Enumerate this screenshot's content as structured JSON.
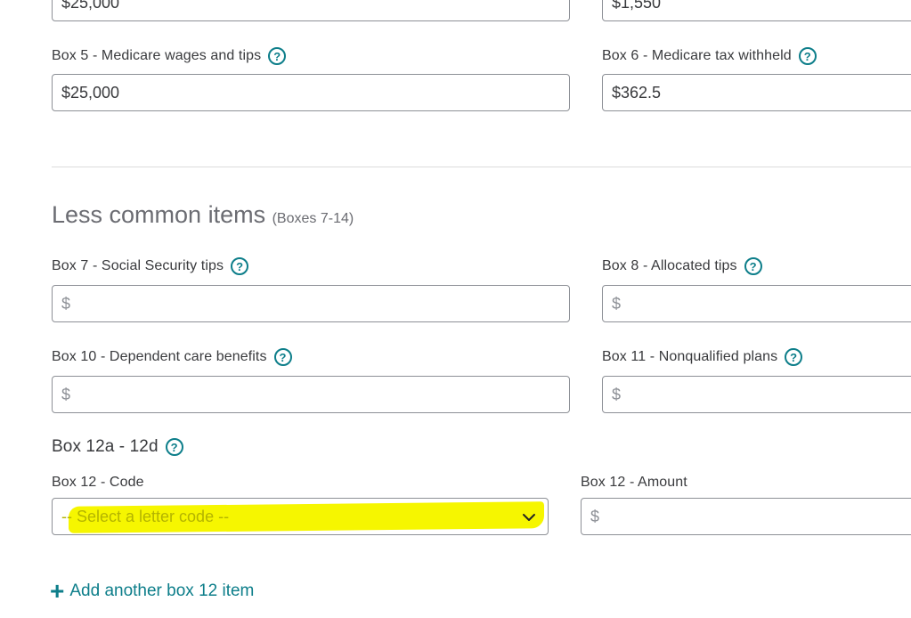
{
  "top_row": {
    "left_value": "$25,000",
    "right_value": "$1,550"
  },
  "box5": {
    "label": "Box 5 - Medicare wages and tips",
    "value": "$25,000"
  },
  "box6": {
    "label": "Box 6 - Medicare tax withheld",
    "value": "$362.5"
  },
  "less_common": {
    "title": "Less common items",
    "subtitle": "(Boxes 7-14)"
  },
  "box7": {
    "label": "Box 7 - Social Security tips",
    "placeholder": "$"
  },
  "box8": {
    "label": "Box 8 - Allocated tips",
    "placeholder": "$"
  },
  "box10": {
    "label": "Box 10 - Dependent care benefits",
    "placeholder": "$"
  },
  "box11": {
    "label": "Box 11 - Nonqualified plans",
    "placeholder": "$"
  },
  "box12": {
    "group_label": "Box 12a - 12d",
    "code_label": "Box 12 - Code",
    "code_selected": "-- Select a letter code --",
    "amount_label": "Box 12 - Amount",
    "amount_placeholder": "$"
  },
  "add_link": {
    "icon": "plus-icon",
    "label": "Add another box 12 item"
  },
  "help_icon": "?",
  "colors": {
    "accent": "#0d7e8a",
    "highlight": "#f6f600",
    "text": "#393a3d",
    "border": "#8d9096"
  }
}
